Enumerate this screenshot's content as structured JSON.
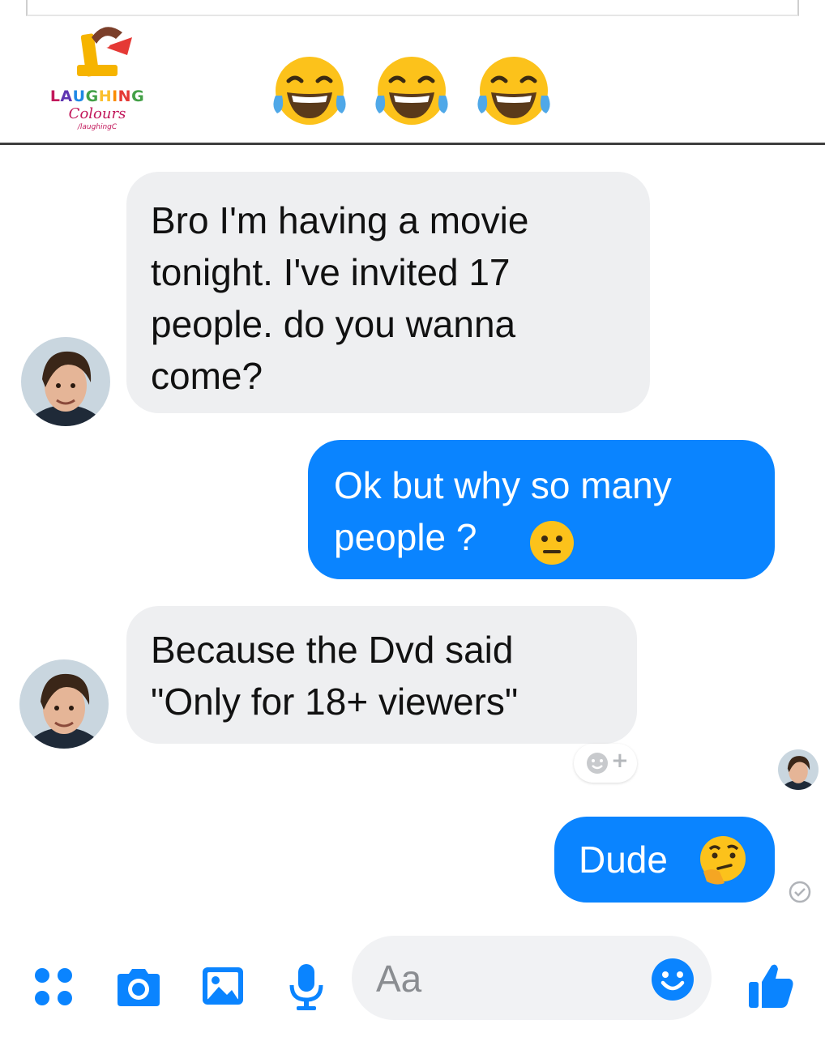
{
  "logo": {
    "title_letters": [
      "L",
      "A",
      "U",
      "G",
      "H",
      "I",
      "N",
      "G"
    ],
    "title_colors": [
      "#c2185b",
      "#5e35b1",
      "#1e88e5",
      "#43a047",
      "#fdd835",
      "#fb8c00",
      "#e53935",
      "#8e24aa"
    ],
    "subtitle": "Colours",
    "handle": "/laughingC"
  },
  "header": {
    "emojis": [
      "tears-of-joy-emoji",
      "tears-of-joy-emoji",
      "tears-of-joy-emoji"
    ]
  },
  "messages": [
    {
      "id": "m1",
      "side": "incoming",
      "text": "Bro I'm having a movie\ntonight. I've invited 17\npeople. do you wanna\ncome?"
    },
    {
      "id": "m2",
      "side": "outgoing",
      "text": "Ok but why so many\npeople  ?",
      "emoji": "neutral-face-emoji"
    },
    {
      "id": "m3",
      "side": "incoming",
      "text": "Because the Dvd said\n\"Only for 18+ viewers\""
    },
    {
      "id": "m4",
      "side": "outgoing",
      "text": "Dude",
      "emoji": "thinking-face-emoji"
    }
  ],
  "reaction_button": {
    "icon": "add-reaction-icon",
    "plus": "+"
  },
  "composer": {
    "placeholder": "Aa"
  },
  "toolbar": {
    "icons": [
      "menu-dots-icon",
      "camera-icon",
      "gallery-icon",
      "microphone-icon",
      "emoji-icon",
      "thumbs-up-icon"
    ]
  },
  "colors": {
    "outgoing_bubble": "#0a84ff",
    "incoming_bubble": "#eeeff1",
    "accent": "#0a84ff"
  }
}
